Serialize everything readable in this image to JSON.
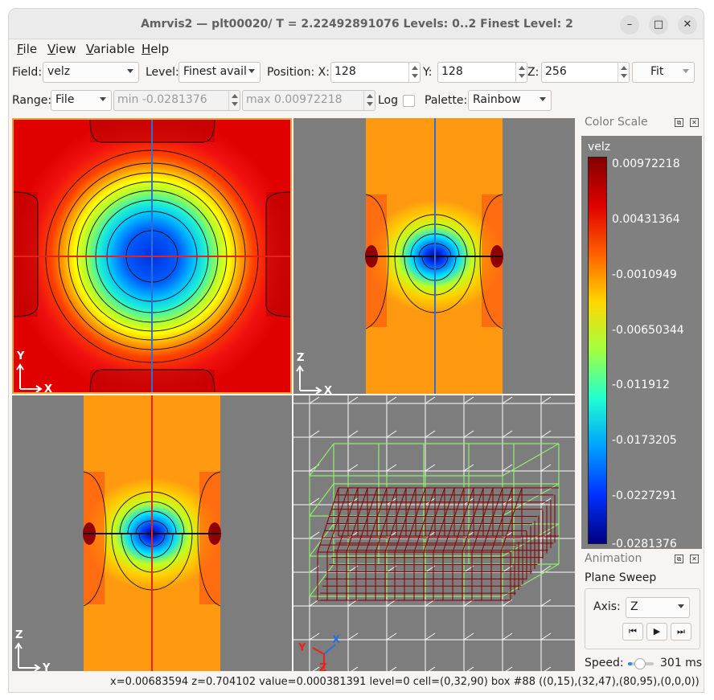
{
  "window": {
    "title": "Amrvis2 — plt00020/  T = 2.22492891076  Levels: 0..2  Finest Level: 2",
    "minimize_glyph": "–",
    "maximize_glyph": "□",
    "close_glyph": "✕"
  },
  "menu": [
    "File",
    "View",
    "Variable",
    "Help"
  ],
  "toolbar1": {
    "field_label": "Field:",
    "field_value": "velz",
    "level_label": "Level:",
    "level_value": "Finest avail",
    "position_label": "Position: X:",
    "x_value": "128",
    "y_label": "Y:",
    "y_value": "128",
    "z_label": "Z:",
    "z_value": "256",
    "fit_label": "Fit"
  },
  "toolbar2": {
    "range_label": "Range:",
    "range_value": "File",
    "min_value": "min -0.0281376",
    "max_value": "max 0.00972218",
    "log_label": "Log",
    "palette_label": "Palette:",
    "palette_value": "Rainbow"
  },
  "views": {
    "xy": {
      "vertical_axis": "Y",
      "horizontal_axis": "X"
    },
    "xz": {
      "vertical_axis": "Z",
      "horizontal_axis": "X"
    },
    "yz": {
      "vertical_axis": "Z",
      "horizontal_axis": "Y"
    },
    "iso": {
      "axis_y": "Y",
      "axis_x": "X",
      "axis_z": "Z"
    }
  },
  "color_scale": {
    "panel_title": "Color Scale",
    "variable": "velz",
    "labels": [
      "0.00972218",
      "0.00431364",
      "-0.0010949",
      "-0.00650344",
      "-0.011912",
      "-0.0173205",
      "-0.0227291",
      "-0.0281376"
    ],
    "gradient_colors": [
      "#800000",
      "#e00000",
      "#ff6000",
      "#ffd800",
      "#a0ff40",
      "#20ffd0",
      "#00a0ff",
      "#0030ff",
      "#000080"
    ]
  },
  "animation": {
    "panel_title": "Animation",
    "mode": "Plane Sweep",
    "axis_label": "Axis:",
    "axis_value": "Z",
    "speed_label": "Speed:",
    "speed_value": "301 ms",
    "speed_level": 0.15
  },
  "status": {
    "text": "x=0.00683594 z=0.704102 value=0.000381391 level=0 cell=(0,32,90) box #88 ((0,15),(32,47),(80,95),(0,0,0))"
  },
  "colors": {
    "xhair_red": "#e8221a",
    "xhair_blue": "#2d6fd6",
    "selected_border": "#f0a030",
    "grid_level0": "#ffffff",
    "grid_level1": "#90ee70",
    "grid_level2": "#800000"
  }
}
